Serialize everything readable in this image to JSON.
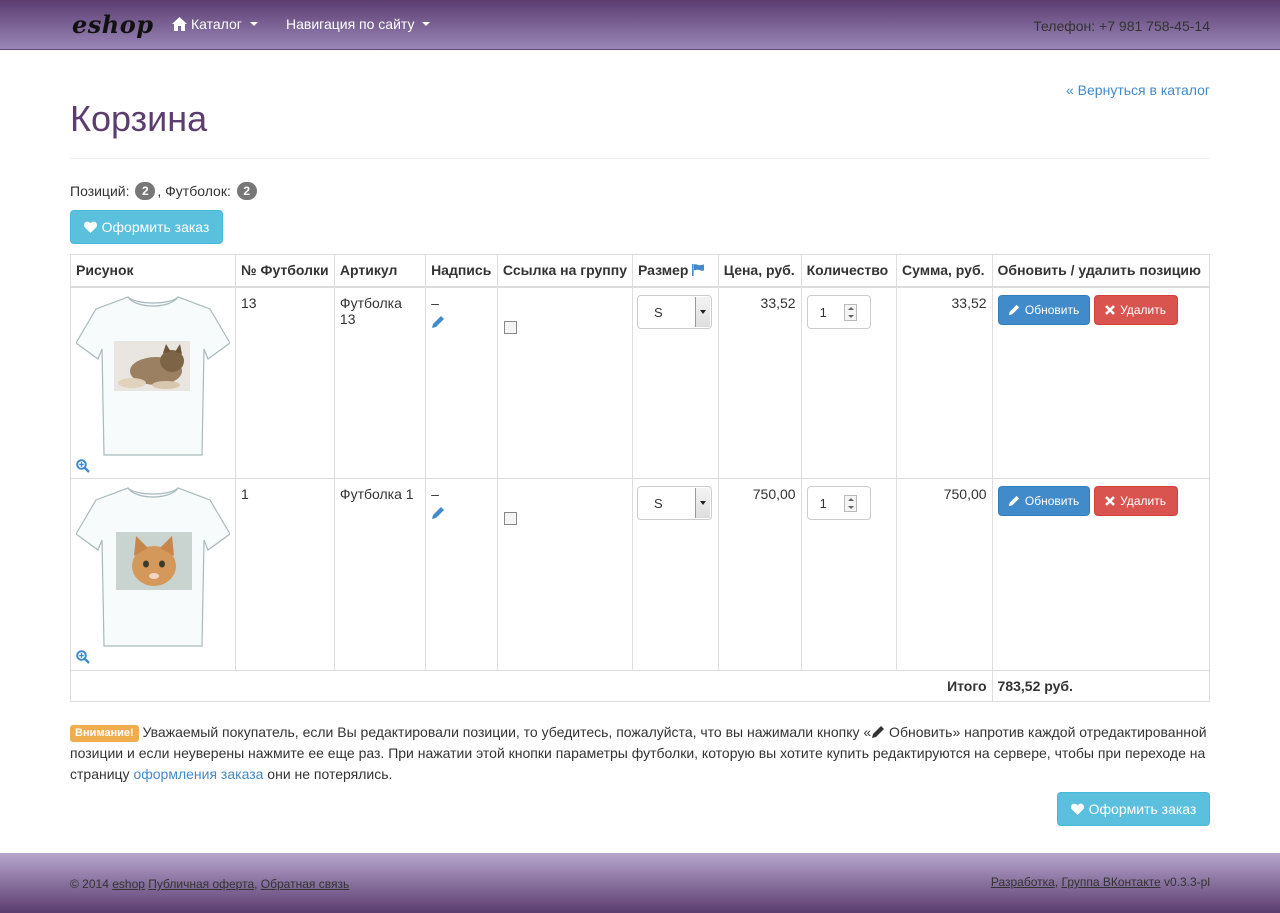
{
  "nav": {
    "brand": "eshop",
    "catalog": "Каталог",
    "site_nav": "Навигация по сайту",
    "phone": "Телефон: +7 981 758-45-14"
  },
  "page": {
    "back_link": "« Вернуться в каталог",
    "title": "Корзина",
    "positions_label": "Позиций:",
    "positions_count": "2",
    "shirts_label": ", Футболок:",
    "shirts_count": "2",
    "order_button": "Оформить заказ"
  },
  "table": {
    "headers": [
      "Рисунок",
      "№ Футболки",
      "Артикул",
      "Надпись",
      "Ссылка на группу",
      "Размер",
      "Цена, руб.",
      "Количество",
      "Сумма, руб.",
      "Обновить / удалить позицию"
    ],
    "rows": [
      {
        "number": "13",
        "article": "Футболка 13",
        "inscription": "–",
        "size": "S",
        "price": "33,52",
        "quantity": "1",
        "sum": "33,52"
      },
      {
        "number": "1",
        "article": "Футболка 1",
        "inscription": "–",
        "size": "S",
        "price": "750,00",
        "quantity": "1",
        "sum": "750,00"
      }
    ],
    "update_label": "Обновить",
    "delete_label": "Удалить",
    "total_label": "Итого",
    "total_value": "783,52 руб."
  },
  "warning": {
    "badge": "Внимание!",
    "text_1": " Уважаемый покупатель, если Вы редактировали позиции, то убедитесь, пожалуйста, что вы нажимали кнопку «",
    "text_2": " Обновить» напротив каждой отредактированной позиции и если неуверены нажмите ее еще раз. При нажатии этой кнопки параметры футболки, которую вы хотите купить редактируются на сервере, чтобы при переходе на страницу ",
    "link": "оформления заказа",
    "text_3": " они не потерялись."
  },
  "footer": {
    "copyright": "© 2014",
    "brand_link": "eshop",
    "offer_link": "Публичная оферта",
    "feedback_link": "Обратная связь",
    "dev_link": "Разработка",
    "vk_link": "Группа ВКонтакте",
    "version": "v0.3.3-pl"
  },
  "colors": {
    "brand_purple": "#5b3d70",
    "info": "#5bc0de",
    "primary": "#428bca",
    "danger": "#d9534f",
    "warning": "#f0ad4e"
  }
}
